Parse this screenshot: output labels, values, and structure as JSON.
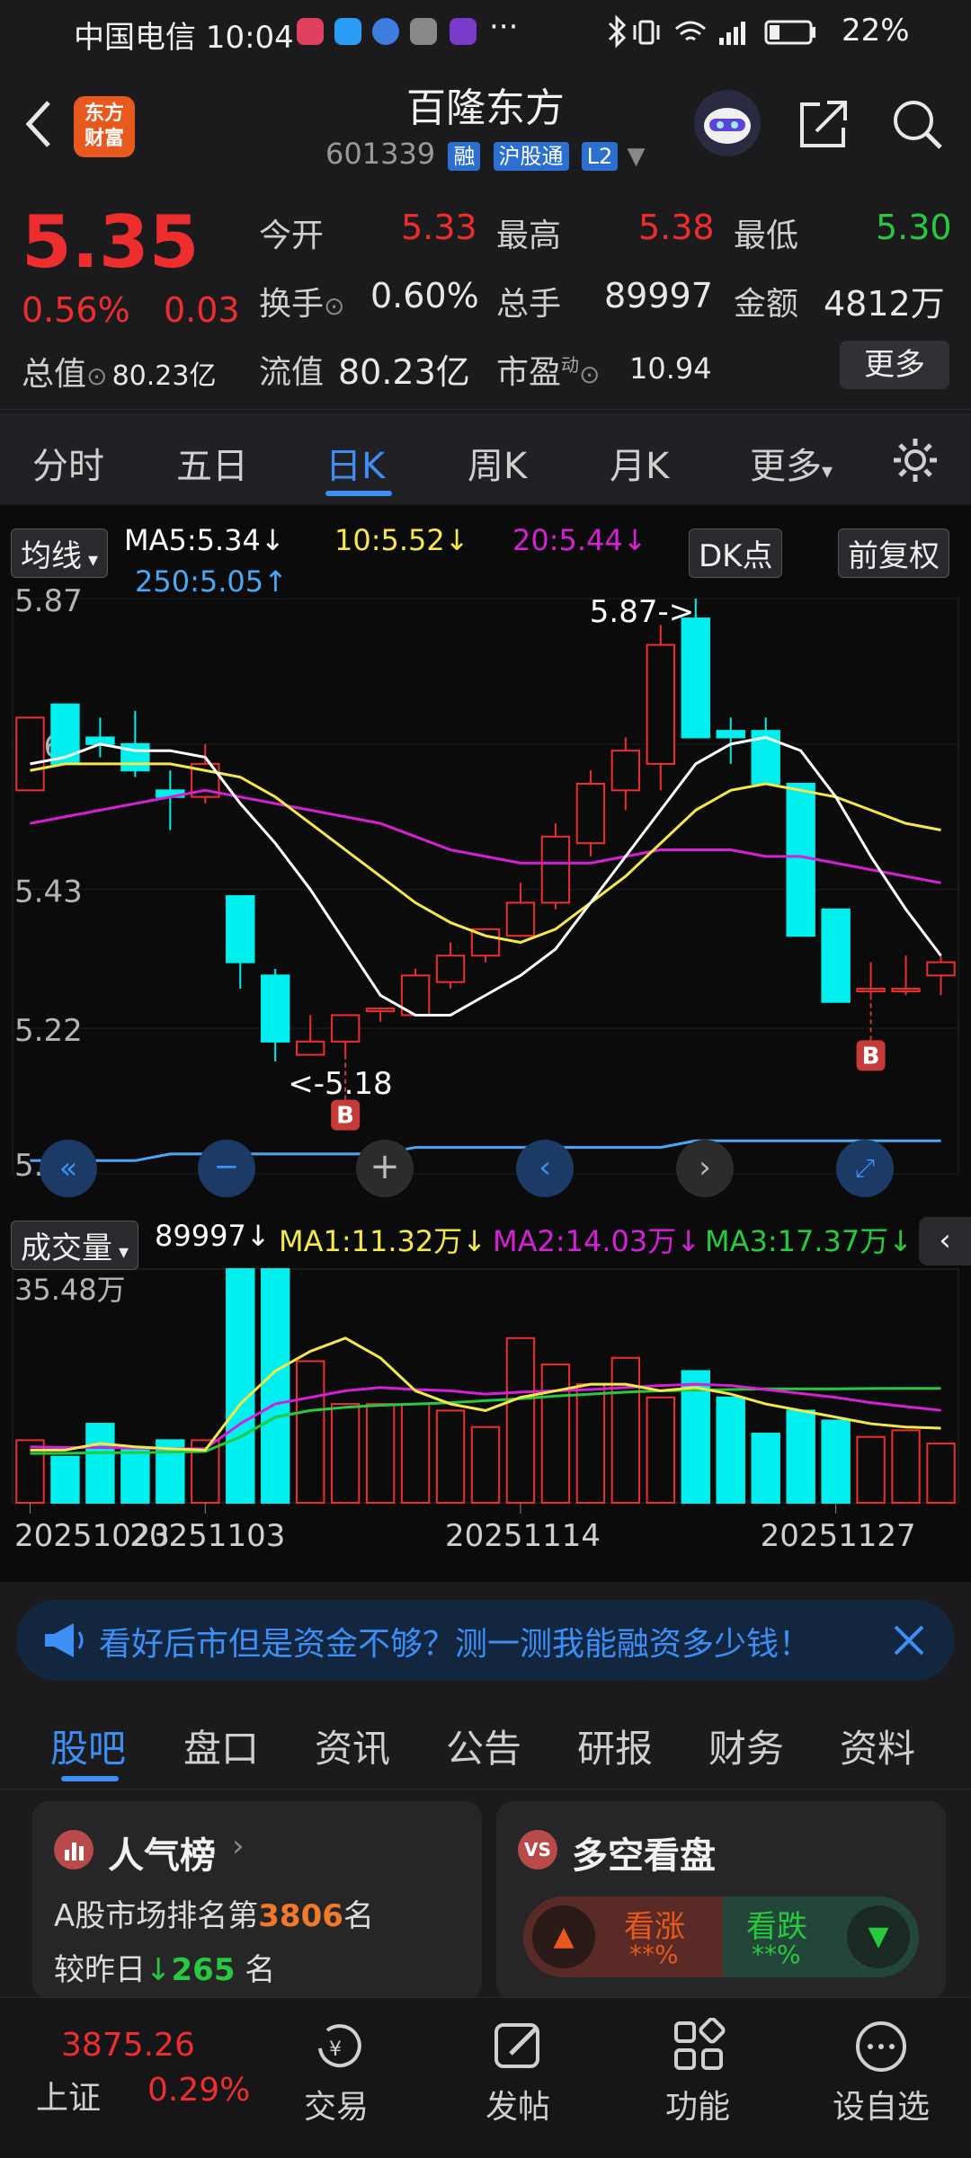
{
  "status_bar": {
    "carrier_time": "中国电信 10:04",
    "dots": "···",
    "battery": "22%"
  },
  "header": {
    "logo_text_1": "东方",
    "logo_text_2": "财富",
    "stock_name": "百隆东方",
    "stock_code": "601339",
    "badges": [
      "融",
      "沪股通",
      "L2"
    ]
  },
  "quote": {
    "price": "5.35",
    "change_pct": "0.56%",
    "change_amt": "0.03",
    "open_label": "今开",
    "open": "5.33",
    "high_label": "最高",
    "high": "5.38",
    "low_label": "最低",
    "low": "5.30",
    "turnover_label": "换手",
    "turnover": "0.60%",
    "volume_label": "总手",
    "volume": "89997",
    "amount_label": "金额",
    "amount": "4812万",
    "total_cap_label": "总值",
    "total_cap": "80.23亿",
    "float_cap_label": "流值",
    "float_cap": "80.23亿",
    "pe_label": "市盈",
    "pe_sup": "动",
    "pe": "10.94",
    "more_label": "更多"
  },
  "k_tabs": {
    "items": [
      "分时",
      "五日",
      "日K",
      "周K",
      "月K",
      "更多"
    ],
    "active": 2
  },
  "indicators": {
    "ma_btn": "均线",
    "ma5": "MA5:5.34↓",
    "ma10": "10:5.52↓",
    "ma20": "20:5.44↓",
    "ma250": "250:5.05↑",
    "dk_btn": "DK点",
    "adjust_btn": "前复权",
    "vol_btn": "成交量",
    "vol_now": "89997↓",
    "vol_ma1": "MA1:11.32万↓",
    "vol_ma2": "MA2:14.03万↓",
    "vol_ma3": "MA3:17.37万↓"
  },
  "chart_data": {
    "type": "candlestick",
    "y_ticks": [
      "5.87",
      "5.65",
      "5.43",
      "5.22",
      "5.00"
    ],
    "ylim": [
      5.0,
      5.87
    ],
    "vol_max_label": "35.48万",
    "vol_max": 354800,
    "x_tick_labels": [
      "20251023",
      "20251103",
      "20251114",
      "20251127"
    ],
    "annotation_high": "5.87->",
    "annotation_low": "<-5.18",
    "buy_marker": "B",
    "candles": [
      {
        "o": 5.58,
        "h": 5.69,
        "l": 5.58,
        "c": 5.69
      },
      {
        "o": 5.71,
        "h": 5.71,
        "l": 5.62,
        "c": 5.62
      },
      {
        "o": 5.66,
        "h": 5.69,
        "l": 5.63,
        "c": 5.65
      },
      {
        "o": 5.65,
        "h": 5.7,
        "l": 5.6,
        "c": 5.61
      },
      {
        "o": 5.58,
        "h": 5.61,
        "l": 5.52,
        "c": 5.57
      },
      {
        "o": 5.57,
        "h": 5.65,
        "l": 5.56,
        "c": 5.62
      },
      {
        "o": 5.42,
        "h": 5.42,
        "l": 5.28,
        "c": 5.32
      },
      {
        "o": 5.3,
        "h": 5.31,
        "l": 5.17,
        "c": 5.2
      },
      {
        "o": 5.18,
        "h": 5.24,
        "l": 5.18,
        "c": 5.2
      },
      {
        "o": 5.2,
        "h": 5.24,
        "l": 5.18,
        "c": 5.24
      },
      {
        "o": 5.25,
        "h": 5.25,
        "l": 5.23,
        "c": 5.25
      },
      {
        "o": 5.24,
        "h": 5.31,
        "l": 5.24,
        "c": 5.3
      },
      {
        "o": 5.29,
        "h": 5.35,
        "l": 5.28,
        "c": 5.33
      },
      {
        "o": 5.33,
        "h": 5.37,
        "l": 5.32,
        "c": 5.37
      },
      {
        "o": 5.36,
        "h": 5.44,
        "l": 5.36,
        "c": 5.41
      },
      {
        "o": 5.41,
        "h": 5.53,
        "l": 5.4,
        "c": 5.51
      },
      {
        "o": 5.5,
        "h": 5.61,
        "l": 5.48,
        "c": 5.59
      },
      {
        "o": 5.58,
        "h": 5.66,
        "l": 5.55,
        "c": 5.64
      },
      {
        "o": 5.62,
        "h": 5.83,
        "l": 5.58,
        "c": 5.8
      },
      {
        "o": 5.84,
        "h": 5.87,
        "l": 5.66,
        "c": 5.66
      },
      {
        "o": 5.67,
        "h": 5.69,
        "l": 5.62,
        "c": 5.66
      },
      {
        "o": 5.67,
        "h": 5.69,
        "l": 5.59,
        "c": 5.59
      },
      {
        "o": 5.59,
        "h": 5.59,
        "l": 5.36,
        "c": 5.36
      },
      {
        "o": 5.4,
        "h": 5.4,
        "l": 5.26,
        "c": 5.26
      },
      {
        "o": 5.28,
        "h": 5.32,
        "l": 5.27,
        "c": 5.28
      },
      {
        "o": 5.28,
        "h": 5.33,
        "l": 5.27,
        "c": 5.28
      },
      {
        "o": 5.3,
        "h": 5.33,
        "l": 5.27,
        "c": 5.32
      }
    ],
    "volumes": [
      95000,
      70000,
      120000,
      80000,
      95000,
      95000,
      354800,
      354800,
      215000,
      150000,
      150000,
      150000,
      140000,
      115000,
      250000,
      210000,
      180000,
      220000,
      160000,
      200000,
      160000,
      105000,
      140000,
      125000,
      100000,
      110000,
      90000
    ],
    "ma5": [
      5.62,
      5.63,
      5.65,
      5.64,
      5.64,
      5.63,
      5.56,
      5.5,
      5.43,
      5.35,
      5.27,
      5.24,
      5.24,
      5.27,
      5.3,
      5.34,
      5.41,
      5.48,
      5.55,
      5.62,
      5.65,
      5.66,
      5.64,
      5.57,
      5.48,
      5.4,
      5.33
    ],
    "ma10": [
      5.61,
      5.62,
      5.62,
      5.62,
      5.62,
      5.61,
      5.6,
      5.57,
      5.53,
      5.49,
      5.45,
      5.41,
      5.38,
      5.36,
      5.35,
      5.37,
      5.41,
      5.45,
      5.5,
      5.55,
      5.58,
      5.59,
      5.58,
      5.57,
      5.55,
      5.53,
      5.52
    ],
    "ma20": [
      5.53,
      5.54,
      5.55,
      5.56,
      5.57,
      5.58,
      5.57,
      5.56,
      5.55,
      5.54,
      5.53,
      5.51,
      5.49,
      5.48,
      5.47,
      5.47,
      5.47,
      5.48,
      5.49,
      5.49,
      5.49,
      5.48,
      5.48,
      5.47,
      5.46,
      5.45,
      5.44
    ],
    "ma250": [
      5.02,
      5.02,
      5.02,
      5.02,
      5.03,
      5.03,
      5.03,
      5.03,
      5.03,
      5.03,
      5.03,
      5.04,
      5.04,
      5.04,
      5.04,
      5.04,
      5.04,
      5.04,
      5.04,
      5.05,
      5.05,
      5.05,
      5.05,
      5.05,
      5.05,
      5.05,
      5.05
    ],
    "vol_ma1": [
      80000,
      80000,
      90000,
      85000,
      82000,
      80000,
      150000,
      200000,
      230000,
      250000,
      220000,
      170000,
      150000,
      140000,
      160000,
      170000,
      180000,
      180000,
      170000,
      175000,
      165000,
      150000,
      140000,
      130000,
      120000,
      115000,
      113200
    ],
    "vol_ma2": [
      85000,
      84000,
      84000,
      83000,
      82000,
      82000,
      120000,
      150000,
      160000,
      170000,
      175000,
      172000,
      170000,
      165000,
      168000,
      170000,
      172000,
      175000,
      178000,
      180000,
      178000,
      172000,
      166000,
      160000,
      152000,
      146000,
      140300
    ],
    "vol_ma3": [
      75000,
      75000,
      76000,
      76000,
      77000,
      78000,
      100000,
      130000,
      140000,
      145000,
      148000,
      150000,
      152000,
      155000,
      158000,
      162000,
      165000,
      168000,
      170000,
      171000,
      172000,
      173000,
      173000,
      173000,
      173500,
      173700,
      173700
    ]
  },
  "banner": {
    "text": "看好后市但是资金不够？测一测我能融资多少钱！"
  },
  "bottom_tabs": {
    "items": [
      "股吧",
      "盘口",
      "资讯",
      "公告",
      "研报",
      "财务",
      "资料"
    ],
    "active": 0
  },
  "rank_card": {
    "title": "人气榜",
    "line1_prefix": "A股市场排名第",
    "rank": "3806",
    "line1_suffix": "名",
    "line2_prefix": "较昨日",
    "delta": "265",
    "line2_suffix": "名"
  },
  "vs_card": {
    "icon": "VS",
    "title": "多空看盘",
    "up_label": "看涨",
    "up_value": "**%",
    "down_label": "看跌",
    "down_value": "**%"
  },
  "bottom_nav": {
    "index_value": "3875.26",
    "index_name": "上证",
    "index_pct": "0.29%",
    "items": [
      "交易",
      "发帖",
      "功能",
      "设自选"
    ]
  },
  "colors": {
    "up": "#ee2e2e",
    "down": "#00f0f0",
    "accent": "#3d8ff5",
    "ma5": "#ffffff",
    "ma10": "#f5e94a",
    "ma20": "#d520d5",
    "ma250": "#4aa8f5"
  }
}
